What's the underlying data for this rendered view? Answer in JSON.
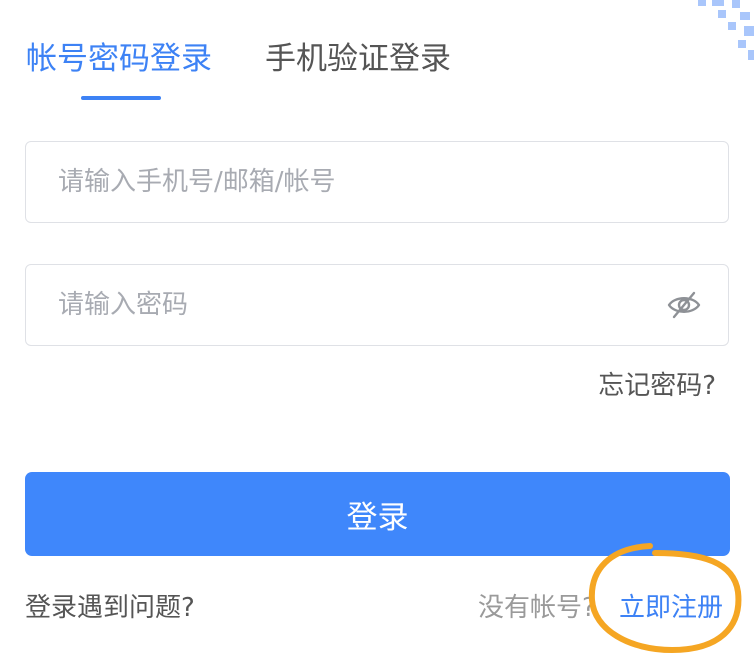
{
  "tabs": {
    "account_login": "帐号密码登录",
    "phone_login": "手机验证登录"
  },
  "form": {
    "username_placeholder": "请输入手机号/邮箱/帐号",
    "password_placeholder": "请输入密码",
    "forgot_password": "忘记密码?",
    "login_button": "登录"
  },
  "footer": {
    "trouble": "登录遇到问题?",
    "no_account": "没有帐号?",
    "register": "立即注册"
  },
  "icons": {
    "password_toggle": "eye-slash-icon",
    "corner": "qr-code-corner-icon"
  },
  "colors": {
    "accent": "#3d82f5",
    "button": "#3f87fb",
    "annotation": "#f5a623"
  }
}
